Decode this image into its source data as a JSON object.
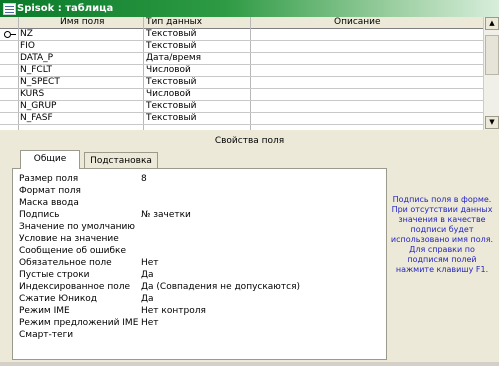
{
  "window": {
    "title": "Spisok : таблица"
  },
  "grid": {
    "headers": {
      "field_name": "Имя поля",
      "data_type": "Тип данных",
      "description": "Описание"
    },
    "rows": [
      {
        "name": "NZ",
        "type": "Текстовый",
        "key": true
      },
      {
        "name": "FIO",
        "type": "Текстовый"
      },
      {
        "name": "DATA_P",
        "type": "Дата/время"
      },
      {
        "name": "N_FCLT",
        "type": "Числовой"
      },
      {
        "name": "N_SPECT",
        "type": "Текстовый"
      },
      {
        "name": "KURS",
        "type": "Числовой"
      },
      {
        "name": "N_GRUP",
        "type": "Текстовый"
      },
      {
        "name": "N_FASF",
        "type": "Текстовый"
      }
    ]
  },
  "properties": {
    "title": "Свойства поля",
    "tabs": [
      "Общие",
      "Подстановка"
    ],
    "rows": [
      {
        "label": "Размер поля",
        "value": "8"
      },
      {
        "label": "Формат поля",
        "value": ""
      },
      {
        "label": "Маска ввода",
        "value": ""
      },
      {
        "label": "Подпись",
        "value": "№ зачетки"
      },
      {
        "label": "Значение по умолчанию",
        "value": ""
      },
      {
        "label": "Условие на значение",
        "value": ""
      },
      {
        "label": "Сообщение об ошибке",
        "value": ""
      },
      {
        "label": "Обязательное поле",
        "value": "Нет"
      },
      {
        "label": "Пустые строки",
        "value": "Да"
      },
      {
        "label": "Индексированное поле",
        "value": "Да (Совпадения не допускаются)"
      },
      {
        "label": "Сжатие Юникод",
        "value": "Да"
      },
      {
        "label": "Режим IME",
        "value": "Нет контроля"
      },
      {
        "label": "Режим предложений IME",
        "value": "Нет"
      },
      {
        "label": "Смарт-теги",
        "value": ""
      }
    ],
    "hint": "Подпись поля в форме. При отсутствии данных значения в качестве подписи будет использовано имя поля. Для справки по подписям полей нажмите клавишу F1."
  }
}
